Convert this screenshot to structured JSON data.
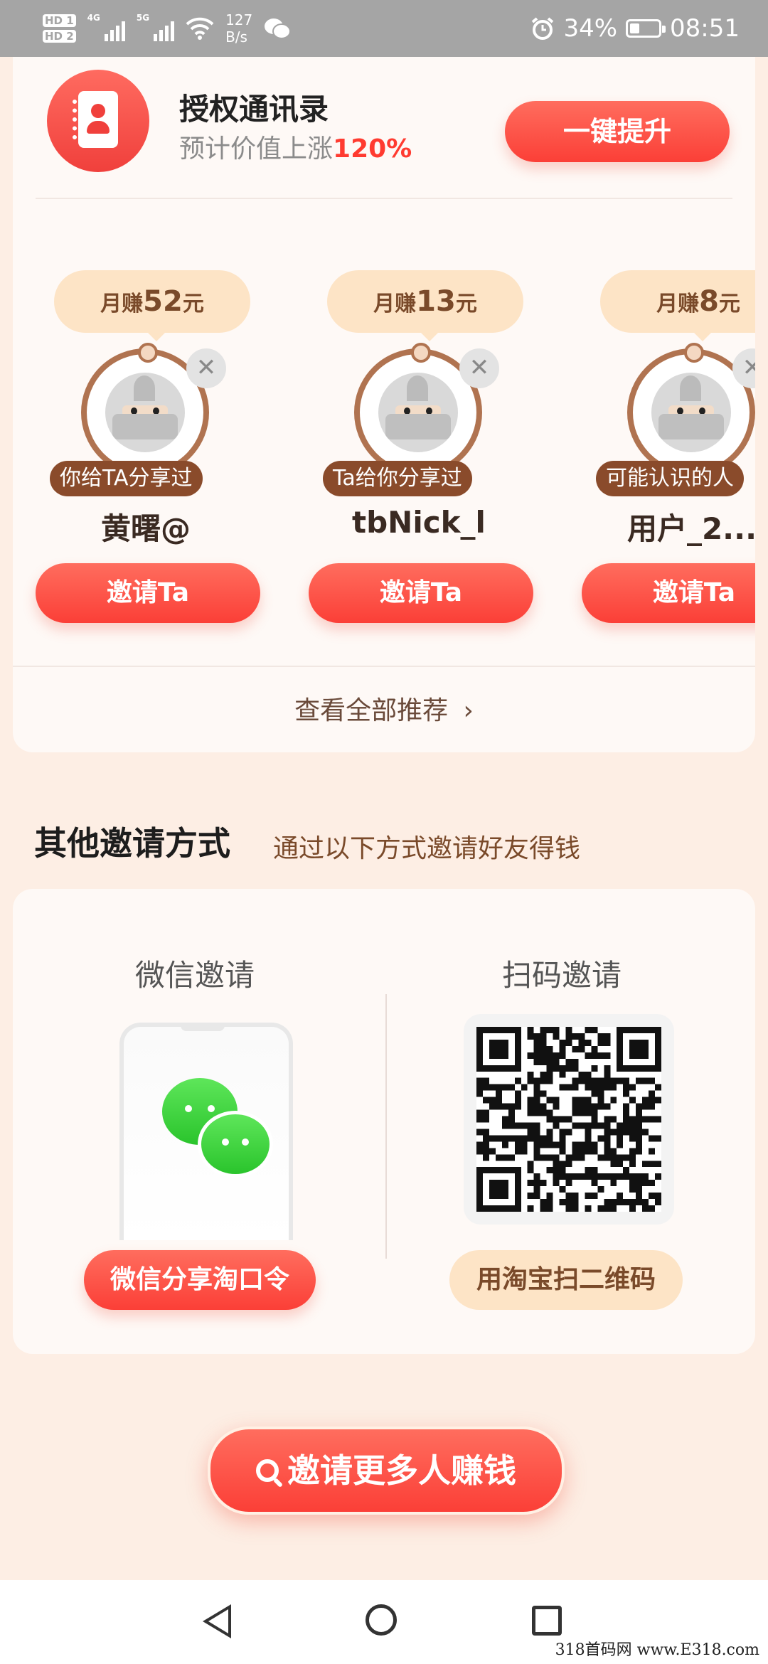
{
  "status_bar": {
    "hd1": "HD 1",
    "hd2": "HD 2",
    "net1": "4G",
    "net2": "5G",
    "speed_value": "127",
    "speed_unit": "B/s",
    "battery_percent": 34,
    "battery_text": "34%",
    "time": "08:51"
  },
  "auth": {
    "title": "授权通讯录",
    "subtitle": "预计价值上涨",
    "subtitle_highlight": "120%",
    "button": "一键提升"
  },
  "recommendations": [
    {
      "earn_prefix": "月赚",
      "earn_amount": "52",
      "earn_suffix": "元",
      "relation": "你给TA分享过",
      "name": "黄曙@",
      "invite": "邀请Ta"
    },
    {
      "earn_prefix": "月赚",
      "earn_amount": "13",
      "earn_suffix": "元",
      "relation": "Ta给你分享过",
      "name": "tbNick_l",
      "invite": "邀请Ta"
    },
    {
      "earn_prefix": "月赚",
      "earn_amount": "8",
      "earn_suffix": "元",
      "relation": "可能认识的人",
      "name": "用户_2...",
      "invite": "邀请Ta"
    }
  ],
  "see_all": "查看全部推荐",
  "other": {
    "title": "其他邀请方式",
    "subtitle": "通过以下方式邀请好友得钱"
  },
  "wechat": {
    "title": "微信邀请",
    "button": "微信分享淘口令"
  },
  "scan": {
    "title": "扫码邀请",
    "button": "用淘宝扫二维码"
  },
  "invite_more": "邀请更多人赚钱",
  "watermark": "318首码网 www.E318.com",
  "colors": {
    "accent_red": "#fb3f37",
    "page_bg": "#fdeee4",
    "brown": "#8a4b2b",
    "earn_bg": "#fde4c6"
  }
}
